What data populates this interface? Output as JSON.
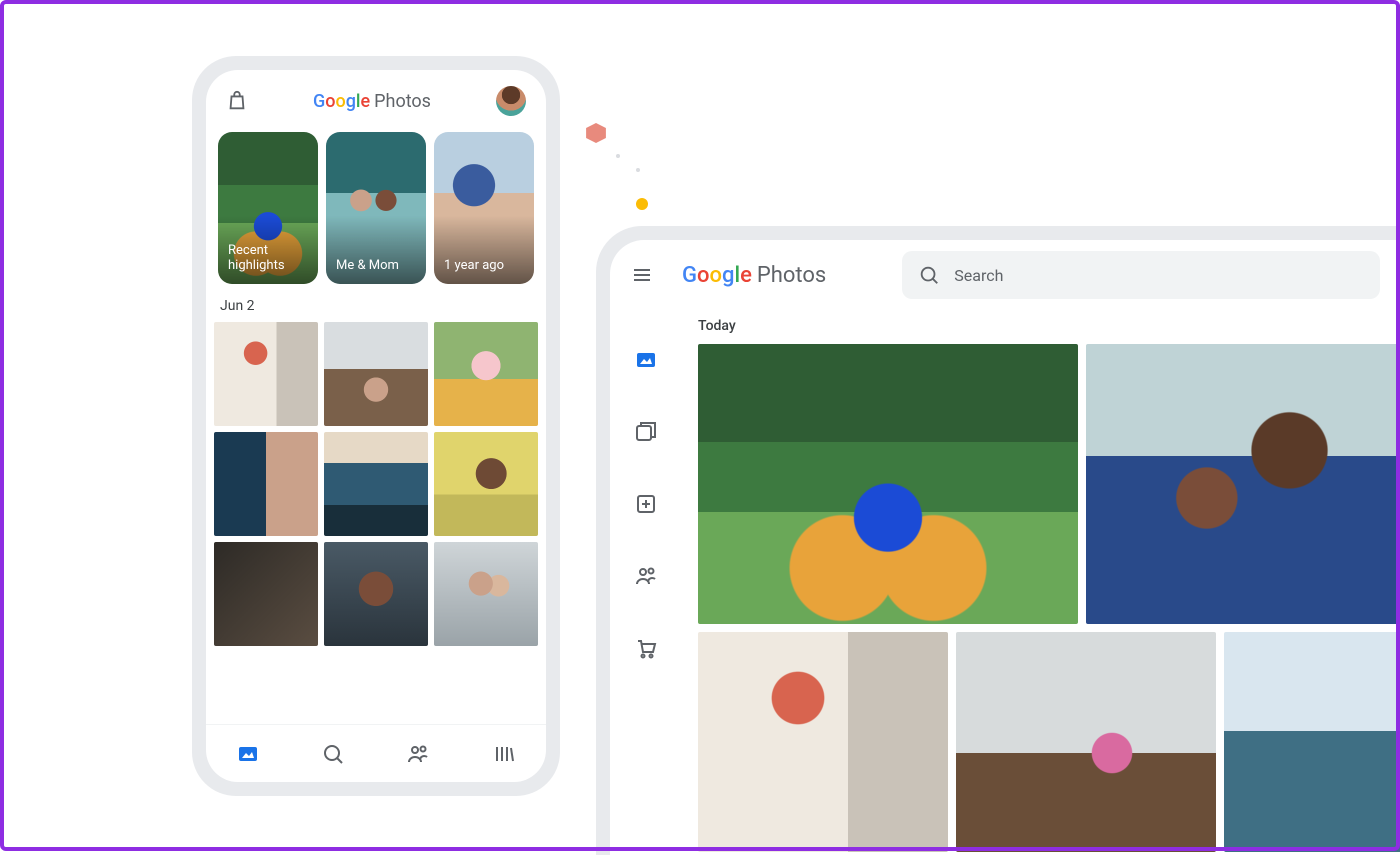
{
  "app_name_suffix": "Photos",
  "google_letters": [
    "G",
    "o",
    "o",
    "g",
    "l",
    "e"
  ],
  "google_colors": [
    "#4285F4",
    "#EA4335",
    "#FBBC05",
    "#4285F4",
    "#34A853",
    "#EA4335"
  ],
  "mobile": {
    "memories": [
      {
        "label": "Recent highlights"
      },
      {
        "label": "Me & Mom"
      },
      {
        "label": "1 year ago"
      }
    ],
    "section_date": "Jun 2",
    "tabs": [
      "photos",
      "search",
      "sharing",
      "library"
    ],
    "active_tab": "photos"
  },
  "desktop": {
    "search_placeholder": "Search",
    "section_label": "Today",
    "side_items": [
      "photos",
      "explore",
      "utilities",
      "sharing",
      "print-store"
    ],
    "active_side": "photos"
  }
}
